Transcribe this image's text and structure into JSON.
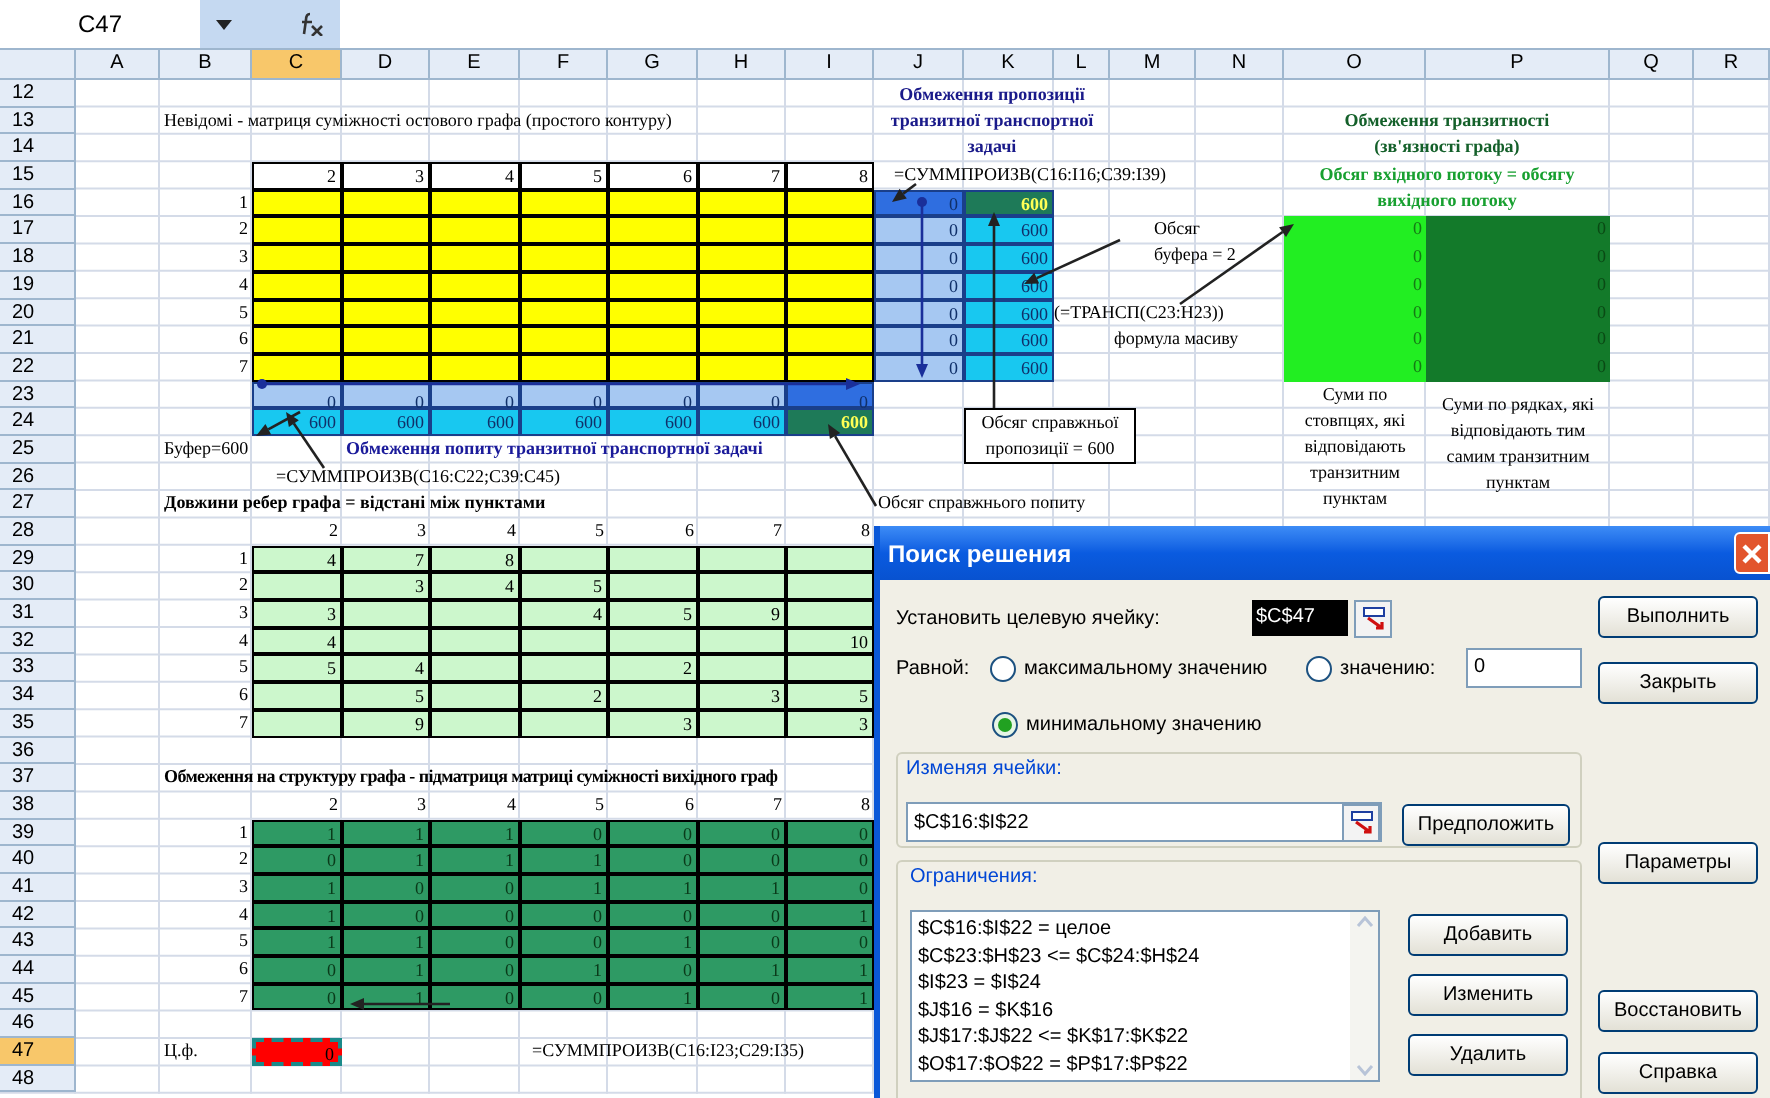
{
  "formula_bar": {
    "name_box": "C47"
  },
  "columns": [
    {
      "label": "A",
      "selected": false
    },
    {
      "label": "B",
      "selected": false
    },
    {
      "label": "C",
      "selected": true
    },
    {
      "label": "D",
      "selected": false
    },
    {
      "label": "E",
      "selected": false
    },
    {
      "label": "F",
      "selected": false
    },
    {
      "label": "G",
      "selected": false
    },
    {
      "label": "H",
      "selected": false
    },
    {
      "label": "I",
      "selected": false
    },
    {
      "label": "J",
      "selected": false
    },
    {
      "label": "K",
      "selected": false
    },
    {
      "label": "L",
      "selected": false
    },
    {
      "label": "M",
      "selected": false
    },
    {
      "label": "N",
      "selected": false
    },
    {
      "label": "O",
      "selected": false
    },
    {
      "label": "P",
      "selected": false
    },
    {
      "label": "Q",
      "selected": false
    },
    {
      "label": "R",
      "selected": false
    }
  ],
  "rows": [
    {
      "label": "12",
      "selected": false
    },
    {
      "label": "13",
      "selected": false
    },
    {
      "label": "14",
      "selected": false
    },
    {
      "label": "15",
      "selected": false
    },
    {
      "label": "16",
      "selected": false
    },
    {
      "label": "17",
      "selected": false
    },
    {
      "label": "18",
      "selected": false
    },
    {
      "label": "19",
      "selected": false
    },
    {
      "label": "20",
      "selected": false
    },
    {
      "label": "21",
      "selected": false
    },
    {
      "label": "22",
      "selected": false
    },
    {
      "label": "23",
      "selected": false
    },
    {
      "label": "24",
      "selected": false
    },
    {
      "label": "25",
      "selected": false
    },
    {
      "label": "26",
      "selected": false
    },
    {
      "label": "27",
      "selected": false
    },
    {
      "label": "28",
      "selected": false
    },
    {
      "label": "29",
      "selected": false
    },
    {
      "label": "30",
      "selected": false
    },
    {
      "label": "31",
      "selected": false
    },
    {
      "label": "32",
      "selected": false
    },
    {
      "label": "33",
      "selected": false
    },
    {
      "label": "34",
      "selected": false
    },
    {
      "label": "35",
      "selected": false
    },
    {
      "label": "36",
      "selected": false
    },
    {
      "label": "37",
      "selected": false
    },
    {
      "label": "38",
      "selected": false
    },
    {
      "label": "39",
      "selected": false
    },
    {
      "label": "40",
      "selected": false
    },
    {
      "label": "41",
      "selected": false
    },
    {
      "label": "42",
      "selected": false
    },
    {
      "label": "43",
      "selected": false
    },
    {
      "label": "44",
      "selected": false
    },
    {
      "label": "45",
      "selected": false
    },
    {
      "label": "46",
      "selected": false
    },
    {
      "label": "47",
      "selected": true
    },
    {
      "label": "48",
      "selected": false
    }
  ],
  "unknowns": {
    "title": "Невідомі - матриця суміжності остового графа (простого контуру)",
    "col_headers": [
      "2",
      "3",
      "4",
      "5",
      "6",
      "7",
      "8"
    ],
    "row_headers": [
      "1",
      "2",
      "3",
      "4",
      "5",
      "6",
      "7"
    ]
  },
  "demand": {
    "flow_row": [
      "0",
      "0",
      "0",
      "0",
      "0",
      "0",
      "0"
    ],
    "capacity_row": [
      "600",
      "600",
      "600",
      "600",
      "600",
      "600",
      "600"
    ],
    "buffer_label": "Буфер=600",
    "title": "Обмеження попиту транзитної транспортної задачі",
    "formula": "=СУММПРОИЗВ(C16:C22;C39:C45)",
    "demand_note": "Обсяг справжнього попиту"
  },
  "supply": {
    "title": "Обмеження пропозиції транзитної транспортної задачі",
    "formula": "=СУММПРОИЗВ(C16:I16;C39:I39)",
    "flow_col": [
      "0",
      "0",
      "0",
      "0",
      "0",
      "0",
      "0"
    ],
    "capacity_col": [
      "600",
      "600",
      "600",
      "600",
      "600",
      "600",
      "600"
    ],
    "buffer_note": "Обсяг буфера = 2",
    "supply_note": "Обсяг справжньої пропозиції = 600"
  },
  "transit": {
    "title": "Обмеження транзитності (зв'язності графа)",
    "subtitle": "Обсяг вхідного потоку = обсягу вихідного потоку",
    "in_sums": [
      "0",
      "0",
      "0",
      "0",
      "0",
      "0"
    ],
    "out_sums": [
      "0",
      "0",
      "0",
      "0",
      "0",
      "0"
    ],
    "array_formula": "(=ТРАНСП(C23:H23))",
    "array_note": "формула масиву",
    "col_note": "Суми по стовпцях, які відповідають транзитним пунктам",
    "row_note": "Суми по рядках, які відповідають тим самим транзитним пунктам"
  },
  "distances": {
    "title": "Довжини ребер графа = відстані між пунктами",
    "col_headers": [
      "2",
      "3",
      "4",
      "5",
      "6",
      "7",
      "8"
    ],
    "rows": [
      {
        "label": "1",
        "cells": [
          {
            "value": "4"
          },
          {
            "value": "7"
          },
          {
            "value": "8"
          },
          {},
          {},
          {},
          {}
        ]
      },
      {
        "label": "2",
        "cells": [
          {},
          {
            "value": "3"
          },
          {
            "value": "4"
          },
          {
            "value": "5"
          },
          {},
          {},
          {}
        ]
      },
      {
        "label": "3",
        "cells": [
          {
            "value": "3"
          },
          {},
          {},
          {
            "value": "4"
          },
          {
            "value": "5"
          },
          {
            "value": "9"
          },
          {}
        ]
      },
      {
        "label": "4",
        "cells": [
          {
            "value": "4"
          },
          {},
          {},
          {},
          {},
          {},
          {
            "value": "10"
          }
        ]
      },
      {
        "label": "5",
        "cells": [
          {
            "value": "5"
          },
          {
            "value": "4"
          },
          {},
          {},
          {
            "value": "2"
          },
          {},
          {}
        ]
      },
      {
        "label": "6",
        "cells": [
          {},
          {
            "value": "5"
          },
          {},
          {
            "value": "2"
          },
          {},
          {
            "value": "3"
          },
          {
            "value": "5"
          }
        ]
      },
      {
        "label": "7",
        "cells": [
          {},
          {
            "value": "9"
          },
          {},
          {},
          {
            "value": "3"
          },
          {},
          {
            "value": "3"
          }
        ]
      }
    ]
  },
  "structure": {
    "title": "Обмеження на структуру графа - підматриця матриці суміжності вихідного граф",
    "col_headers": [
      "2",
      "3",
      "4",
      "5",
      "6",
      "7",
      "8"
    ],
    "rows": [
      {
        "label": "1",
        "values": [
          "1",
          "1",
          "1",
          "0",
          "0",
          "0",
          "0"
        ]
      },
      {
        "label": "2",
        "values": [
          "0",
          "1",
          "1",
          "1",
          "0",
          "0",
          "0"
        ]
      },
      {
        "label": "3",
        "values": [
          "1",
          "0",
          "0",
          "1",
          "1",
          "1",
          "0"
        ]
      },
      {
        "label": "4",
        "values": [
          "1",
          "0",
          "0",
          "0",
          "0",
          "0",
          "1"
        ]
      },
      {
        "label": "5",
        "values": [
          "1",
          "1",
          "0",
          "0",
          "1",
          "0",
          "0"
        ]
      },
      {
        "label": "6",
        "values": [
          "0",
          "1",
          "0",
          "1",
          "0",
          "1",
          "1"
        ]
      },
      {
        "label": "7",
        "values": [
          "0",
          "1",
          "0",
          "0",
          "1",
          "0",
          "1"
        ]
      }
    ]
  },
  "objective": {
    "label": "Ц.ф.",
    "value": "0",
    "formula": "=СУММПРОИЗВ(C16:I23;C29:I35)"
  },
  "dialog": {
    "title": "Поиск решения",
    "target_label": "Установить целевую ячейку:",
    "target_value": "$C$47",
    "equal_label": "Равной:",
    "options": [
      {
        "label": "максимальному значению",
        "selected": false
      },
      {
        "label": "значению:",
        "selected": false
      },
      {
        "label": "минимальному значению",
        "selected": true
      }
    ],
    "value_field": "0",
    "changing_label": "Изменяя ячейки:",
    "changing_value": "$C$16:$I$22",
    "guess_button": "Предположить",
    "constraints_label": "Ограничения:",
    "constraints": [
      "$C$16:$I$22 = целое",
      "$C$23:$H$23 <= $C$24:$H$24",
      "$I$23 = $I$24",
      "$J$16 = $K$16",
      "$J$17:$J$22 <= $K$17:$K$22",
      "$O$17:$O$22 = $P$17:$P$22"
    ],
    "constraint_buttons": [
      "Добавить",
      "Изменить",
      "Удалить"
    ],
    "side_buttons": [
      "Выполнить",
      "Закрыть",
      "Параметры",
      "Восстановить",
      "Справка"
    ]
  }
}
